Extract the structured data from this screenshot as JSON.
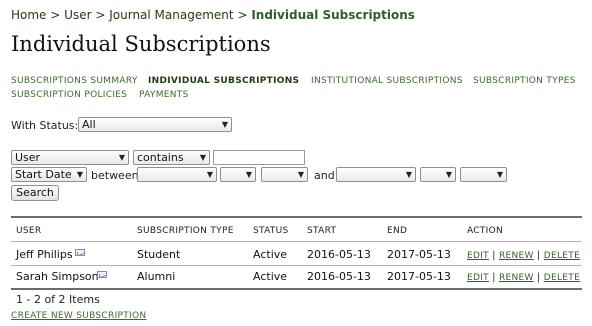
{
  "breadcrumb": {
    "items": [
      "Home",
      "User",
      "Journal Management"
    ],
    "separator": ">",
    "current": "Individual Subscriptions"
  },
  "page_title": "Individual Subscriptions",
  "nav": {
    "row1": [
      "SUBSCRIPTIONS SUMMARY",
      "INDIVIDUAL SUBSCRIPTIONS",
      "INSTITUTIONAL SUBSCRIPTIONS",
      "SUBSCRIPTION TYPES"
    ],
    "row2": [
      "SUBSCRIPTION POLICIES",
      "PAYMENTS"
    ],
    "active": "INDIVIDUAL SUBSCRIPTIONS"
  },
  "filters": {
    "status_label": "With Status:",
    "status_value": "All",
    "field_value": "User",
    "match_value": "contains",
    "search_text": "",
    "date_field_value": "Start Date",
    "between_label": "between",
    "and_label": "and",
    "search_button": "Search"
  },
  "table": {
    "headers": [
      "USER",
      "SUBSCRIPTION TYPE",
      "STATUS",
      "START",
      "END",
      "ACTION"
    ],
    "rows": [
      {
        "user": "Jeff Philips",
        "type": "Student",
        "status": "Active",
        "start": "2016-05-13",
        "end": "2017-05-13"
      },
      {
        "user": "Sarah Simpson",
        "type": "Alumni",
        "status": "Active",
        "start": "2016-05-13",
        "end": "2017-05-13"
      }
    ],
    "actions": [
      "EDIT",
      "RENEW",
      "DELETE"
    ],
    "action_separator": "|"
  },
  "pagination": "1 - 2 of 2 Items",
  "create_link": "CREATE NEW SUBSCRIPTION",
  "colors": {
    "accent": "#355e2a",
    "text": "#222222"
  },
  "icons": [
    "envelope-icon",
    "dropdown-arrow-icon"
  ]
}
